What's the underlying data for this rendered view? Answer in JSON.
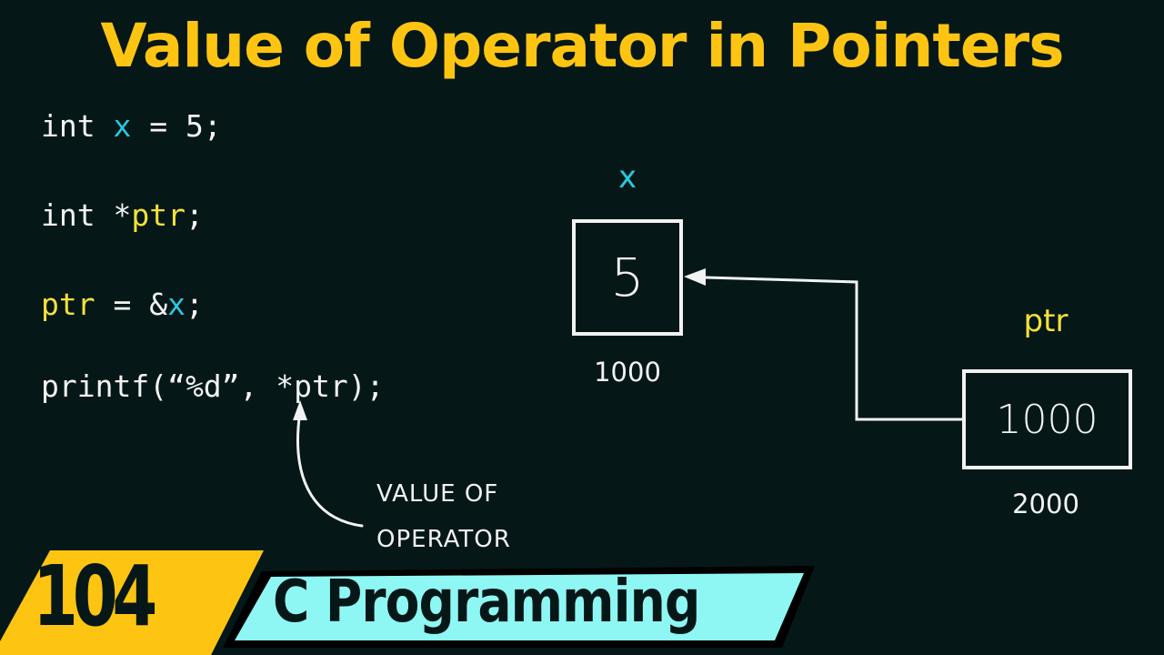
{
  "title": "Value of Operator in Pointers",
  "colors": {
    "background": "#061717",
    "title": "#fdc512",
    "var_x": "#29c9e0",
    "var_ptr": "#f3e13a",
    "foreground": "#f2f2f2",
    "badge_number_bg": "#fdc512",
    "badge_course_bg": "#8ef7f4"
  },
  "code": {
    "line1": {
      "t1": "int ",
      "t2": "x",
      "t3": " = 5;"
    },
    "line2": {
      "t1": "int *",
      "t2": "ptr",
      "t3": ";"
    },
    "line3": {
      "t1": "ptr",
      "t2": " = &",
      "t3": "x",
      "t4": ";"
    },
    "line4": {
      "t1": "printf(“%d”, *ptr);"
    }
  },
  "annotation": {
    "line1": "Value of",
    "line2": "operator"
  },
  "diagram": {
    "x": {
      "label": "x",
      "value": "5",
      "address": "1000"
    },
    "ptr": {
      "label": "ptr",
      "value": "1000",
      "address": "2000"
    }
  },
  "badge": {
    "number": "104",
    "course": "C Programming"
  }
}
